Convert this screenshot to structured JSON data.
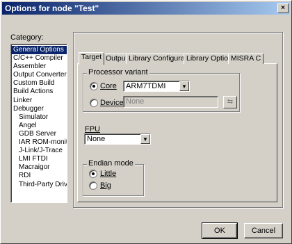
{
  "window": {
    "title": "Options for node \"Test\"",
    "close_glyph": "×"
  },
  "category": {
    "label": "Category:",
    "items": [
      {
        "label": "General Options",
        "indent": false,
        "selected": true
      },
      {
        "label": "C/C++ Compiler",
        "indent": false
      },
      {
        "label": "Assembler",
        "indent": false
      },
      {
        "label": "Output Converter",
        "indent": false
      },
      {
        "label": "Custom Build",
        "indent": false
      },
      {
        "label": "Build Actions",
        "indent": false
      },
      {
        "label": "Linker",
        "indent": false
      },
      {
        "label": "Debugger",
        "indent": false
      },
      {
        "label": "Simulator",
        "indent": true
      },
      {
        "label": "Angel",
        "indent": true
      },
      {
        "label": "GDB Server",
        "indent": true
      },
      {
        "label": "IAR ROM-monitor",
        "indent": true
      },
      {
        "label": "J-Link/J-Trace",
        "indent": true
      },
      {
        "label": "LMI FTDI",
        "indent": true
      },
      {
        "label": "Macraigor",
        "indent": true
      },
      {
        "label": "RDI",
        "indent": true
      },
      {
        "label": "Third-Party Driver",
        "indent": true
      }
    ]
  },
  "tabs": [
    "Target",
    "Output",
    "Library Configuration",
    "Library Options",
    "MISRA C"
  ],
  "processor": {
    "group_title": "Processor variant",
    "core_label": "Core",
    "core_value": "ARM7TDMI",
    "device_label": "Device",
    "device_value": "None",
    "browse_glyph": "⇆"
  },
  "fpu": {
    "label": "FPU",
    "value": "None"
  },
  "endian": {
    "group_title": "Endian mode",
    "little_label": "Little",
    "big_label": "Big"
  },
  "buttons": {
    "ok": "OK",
    "cancel": "Cancel"
  },
  "arrow_glyph": "▼"
}
